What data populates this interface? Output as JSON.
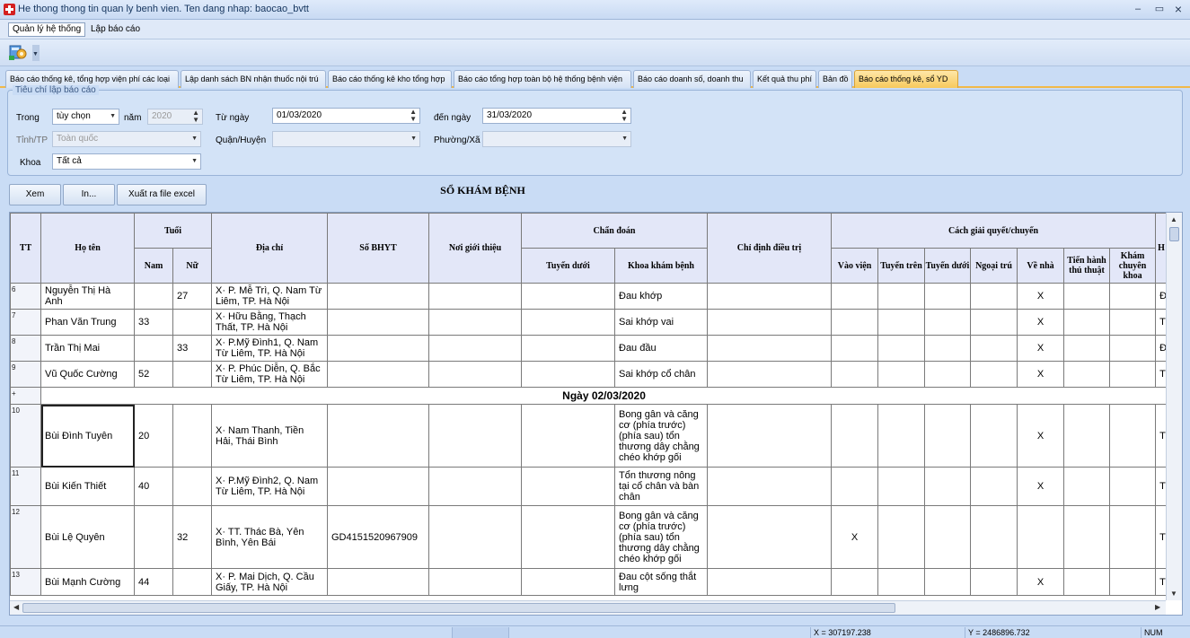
{
  "window": {
    "title": "He thong thong tin quan ly benh vien. Ten dang nhap: baocao_bvtt",
    "minimize": "–",
    "restore": "▭",
    "close": "×"
  },
  "menu": {
    "system": "Quản lý hệ thống",
    "report": "Lập báo cáo"
  },
  "tabs": [
    "Báo cáo thống kê, tổng hợp viện phí các loại",
    "Lập danh sách BN nhận thuốc nội trú",
    "Báo cáo thống kê kho tổng hợp",
    "Báo cáo tổng hợp toàn bộ hệ thống bệnh viện",
    "Báo cáo doanh số, doanh thu",
    "Kết quả thu phí",
    "Bản đồ",
    "Báo cáo thống kê, sổ YD"
  ],
  "filters": {
    "legend": "Tiêu chí lập báo cáo",
    "trong_label": "Trong",
    "trong_value": "tùy chọn",
    "nam_label": "năm",
    "nam_value": "2020",
    "tungay_label": "Từ ngày",
    "tungay_value": "01/03/2020",
    "denngay_label": "đến ngày",
    "denngay_value": "31/03/2020",
    "tinh_label": "Tỉnh/TP",
    "tinh_value": "Toàn quốc",
    "quan_label": "Quận/Huyện",
    "phuong_label": "Phường/Xã",
    "khoa_label": "Khoa",
    "khoa_value": "Tất cả"
  },
  "buttons": {
    "view": "Xem",
    "print": "In...",
    "export": "Xuất ra file excel"
  },
  "report_title": "SỔ KHÁM BỆNH",
  "table": {
    "headers": {
      "tt": "TT",
      "name": "Họ tên",
      "age": "Tuổi",
      "male": "Nam",
      "female": "Nữ",
      "address": "Địa chỉ",
      "bhyt": "Số BHYT",
      "referral": "Nơi giới thiệu",
      "diagnosis": "Chẩn đoán",
      "lower_level": "Tuyến dưới",
      "clinic": "Khoa khám bệnh",
      "treatment": "Chỉ định điều trị",
      "resolution": "Cách giải quyết/chuyển",
      "admitted": "Vào viện",
      "upper": "Tuyến trên",
      "lower": "Tuyến dưới",
      "outpatient": "Ngoại trú",
      "home": "Về nhà",
      "procedure": "Tiến hành thủ thuật",
      "specialist": "Khám chuyên khoa",
      "extra": "H"
    },
    "rows_a": [
      {
        "tt": "6",
        "name": "Nguyễn Thị Hà Anh",
        "nam": "",
        "nu": "27",
        "address": "X· P. Mễ Trì, Q. Nam Từ Liêm, TP. Hà Nội",
        "bhyt": "",
        "clinic": "Đau khớp",
        "admitted": "",
        "home": "X",
        "extra": "Đ"
      },
      {
        "tt": "7",
        "name": "Phan Văn Trung",
        "nam": "33",
        "nu": "",
        "address": "X· Hữu Bằng, Thạch Thất, TP. Hà Nội",
        "bhyt": "",
        "clinic": "Sai khớp vai",
        "admitted": "",
        "home": "X",
        "extra": "T"
      },
      {
        "tt": "8",
        "name": "Trần Thị Mai",
        "nam": "",
        "nu": "33",
        "address": "X· P.Mỹ Đình1, Q. Nam Từ Liêm, TP. Hà Nội",
        "bhyt": "",
        "clinic": "Đau đầu",
        "admitted": "",
        "home": "X",
        "extra": "Đ"
      },
      {
        "tt": "9",
        "name": "Vũ Quốc Cường",
        "nam": "52",
        "nu": "",
        "address": "X· P. Phúc Diễn, Q. Bắc Từ Liêm, TP. Hà Nội",
        "bhyt": "",
        "clinic": "Sai khớp cổ chân",
        "admitted": "",
        "home": "X",
        "extra": "T"
      }
    ],
    "day_marker": "+",
    "day_label": "Ngày 02/03/2020",
    "rows_b": [
      {
        "tt": "10",
        "name": "Bùi Đình Tuyên",
        "nam": "20",
        "nu": "",
        "address": "X· Nam Thanh, Tiền Hải, Thái Bình",
        "bhyt": "",
        "clinic": "Bong gân và căng cơ (phía trước) (phía sau) tổn thương dây chằng chéo khớp gối",
        "admitted": "",
        "home": "X",
        "extra": "T"
      },
      {
        "tt": "11",
        "name": "Bùi Kiến Thiết",
        "nam": "40",
        "nu": "",
        "address": "X· P.Mỹ Đình2, Q. Nam Từ Liêm, TP. Hà Nội",
        "bhyt": "",
        "clinic": "Tổn thương nông tại cổ chân và bàn chân",
        "admitted": "",
        "home": "X",
        "extra": "T"
      },
      {
        "tt": "12",
        "name": "Bùi Lệ Quyên",
        "nam": "",
        "nu": "32",
        "address": "X· TT. Thác Bà, Yên Bình, Yên Bái",
        "bhyt": "GD4151520967909",
        "clinic": "Bong gân và căng cơ (phía trước) (phía sau) tổn thương dây chằng chéo khớp gối",
        "admitted": "X",
        "home": "",
        "extra": "T"
      },
      {
        "tt": "13",
        "name": "Bùi Mạnh Cường",
        "nam": "44",
        "nu": "",
        "address": "X· P. Mai Dịch, Q. Cầu Giấy, TP. Hà Nội",
        "bhyt": "",
        "clinic": "Đau cột sống thắt lưng",
        "admitted": "",
        "home": "X",
        "extra": "T"
      }
    ]
  },
  "status": {
    "x": "X = 307197.238",
    "y": "Y = 2486896.732",
    "num": "NUM"
  }
}
